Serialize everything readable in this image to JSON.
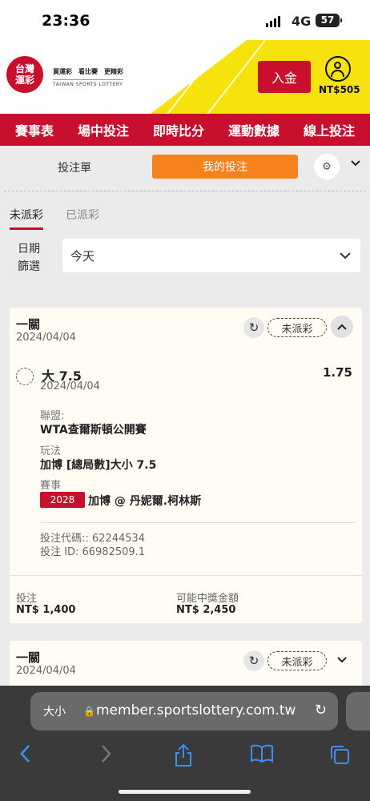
{
  "status_bar": {
    "time": "23:36",
    "network": "4G",
    "battery": "57"
  },
  "header": {
    "logo_line1": "台灣",
    "logo_line2": "運彩",
    "slogan": "買運彩　看比賽　更精彩",
    "slogan_en": "TAIWAN SPORTS LOTTERY",
    "deposit_label": "入金",
    "balance": "NT$505"
  },
  "nav": {
    "items": [
      "賽事表",
      "場中投注",
      "即時比分",
      "運動數據",
      "線上投注"
    ]
  },
  "subtabs": {
    "slip_label": "投注單",
    "mybets_label": "我的投注"
  },
  "filters": {
    "tab_unsettled": "未派彩",
    "tab_settled": "已派彩",
    "date_label_line1": "日期",
    "date_label_line2": "篩選",
    "date_value": "今天"
  },
  "bets": [
    {
      "type": "一關",
      "date": "2024/04/04",
      "status": "未派彩",
      "selection": "大 7.5",
      "selection_date": "2024/04/04",
      "odds": "1.75",
      "league_label": "聯盟:",
      "league": "WTA查爾斯頓公開賽",
      "market_label": "玩法",
      "market": "加博 [總局數]大小 7.5",
      "event_label": "賽事",
      "event_id": "2028",
      "event_name": "加博 @ 丹妮爾.柯林斯",
      "bet_code": "投注代碼:: 62244534",
      "bet_id": "投注 ID: 66982509.1",
      "stake_label": "投注",
      "stake": "NT$ 1,400",
      "win_label": "可能中獎金額",
      "potential_win": "NT$ 2,450"
    },
    {
      "type": "一關",
      "date": "2024/04/04",
      "status": "未派彩"
    }
  ],
  "browser": {
    "text_size": "大小",
    "url": "member.sportslottery.com.tw"
  },
  "colors": {
    "brand_red": "#c8102e",
    "accent_orange": "#f7811b",
    "header_yellow": "#f6e20c",
    "safari_blue": "#3b8ff6"
  }
}
